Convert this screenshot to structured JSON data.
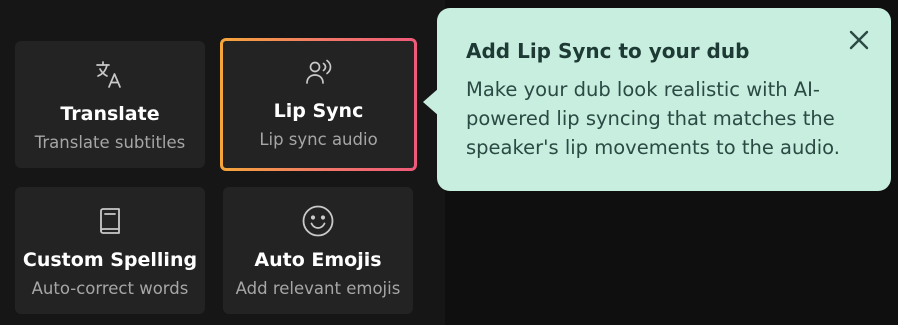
{
  "features": {
    "translate": {
      "title": "Translate",
      "subtitle": "Translate subtitles",
      "icon": "translate-icon"
    },
    "lip_sync": {
      "title": "Lip Sync",
      "subtitle": "Lip sync audio",
      "icon": "speaking-person-icon",
      "selected": true
    },
    "custom_spelling": {
      "title": "Custom Spelling",
      "subtitle": "Auto-correct words",
      "icon": "book-icon"
    },
    "auto_emojis": {
      "title": "Auto Emojis",
      "subtitle": "Add relevant emojis",
      "icon": "smiley-icon"
    }
  },
  "tooltip": {
    "title": "Add Lip Sync to your dub",
    "body": "Make your dub look realistic with AI-powered lip syncing that matches the speaker's lip movements to the audio.",
    "close_icon": "close-icon"
  },
  "colors": {
    "background": "#111111",
    "card": "#232323",
    "tooltip": "#c8eedf",
    "selected_gradient_start": "#f5a63a",
    "selected_gradient_end": "#ef5a7a"
  }
}
